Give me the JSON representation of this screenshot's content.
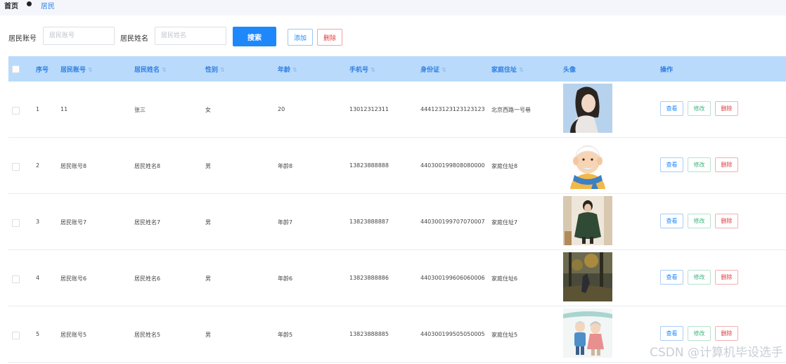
{
  "breadcrumb": {
    "home": "首页",
    "current": "居民"
  },
  "search": {
    "account_label": "居民账号",
    "account_placeholder": "居民账号",
    "name_label": "居民姓名",
    "name_placeholder": "居民姓名",
    "search_button": "搜索",
    "add_button": "添加",
    "delete_button": "删除"
  },
  "table": {
    "columns": [
      "序号",
      "居民账号",
      "居民姓名",
      "性别",
      "年龄",
      "手机号",
      "身份证",
      "家庭住址",
      "头像",
      "操作"
    ],
    "rows": [
      {
        "index": "1",
        "account": "11",
        "name": "张三",
        "gender": "女",
        "age": "20",
        "phone": "13012312311",
        "id_card": "444123123123123123",
        "address": "北京西路一号巷",
        "avatar": "woman-photo"
      },
      {
        "index": "2",
        "account": "居民账号8",
        "name": "居民姓名8",
        "gender": "男",
        "age": "年龄8",
        "phone": "13823888888",
        "id_card": "440300199808080000",
        "address": "家庭住址8",
        "avatar": "elder-cartoon"
      },
      {
        "index": "3",
        "account": "居民账号7",
        "name": "居民姓名7",
        "gender": "男",
        "age": "年龄7",
        "phone": "13823888887",
        "id_card": "440300199707070007",
        "address": "家庭住址7",
        "avatar": "coat-photo"
      },
      {
        "index": "4",
        "account": "居民账号6",
        "name": "居民姓名6",
        "gender": "男",
        "age": "年龄6",
        "phone": "13823888886",
        "id_card": "440300199606060006",
        "address": "家庭住址6",
        "avatar": "forest-photo"
      },
      {
        "index": "5",
        "account": "居民账号5",
        "name": "居民姓名5",
        "gender": "男",
        "age": "年龄5",
        "phone": "13823888885",
        "id_card": "440300199505050005",
        "address": "家庭住址5",
        "avatar": "elderly-couple"
      }
    ],
    "actions": {
      "view": "查看",
      "edit": "修改",
      "delete": "删除"
    }
  },
  "watermark": "CSDN @计算机毕设选手",
  "colors": {
    "primary": "#1e88fb",
    "header_bg": "#b9dafb",
    "danger": "#e0393e",
    "success": "#3fb27f"
  }
}
